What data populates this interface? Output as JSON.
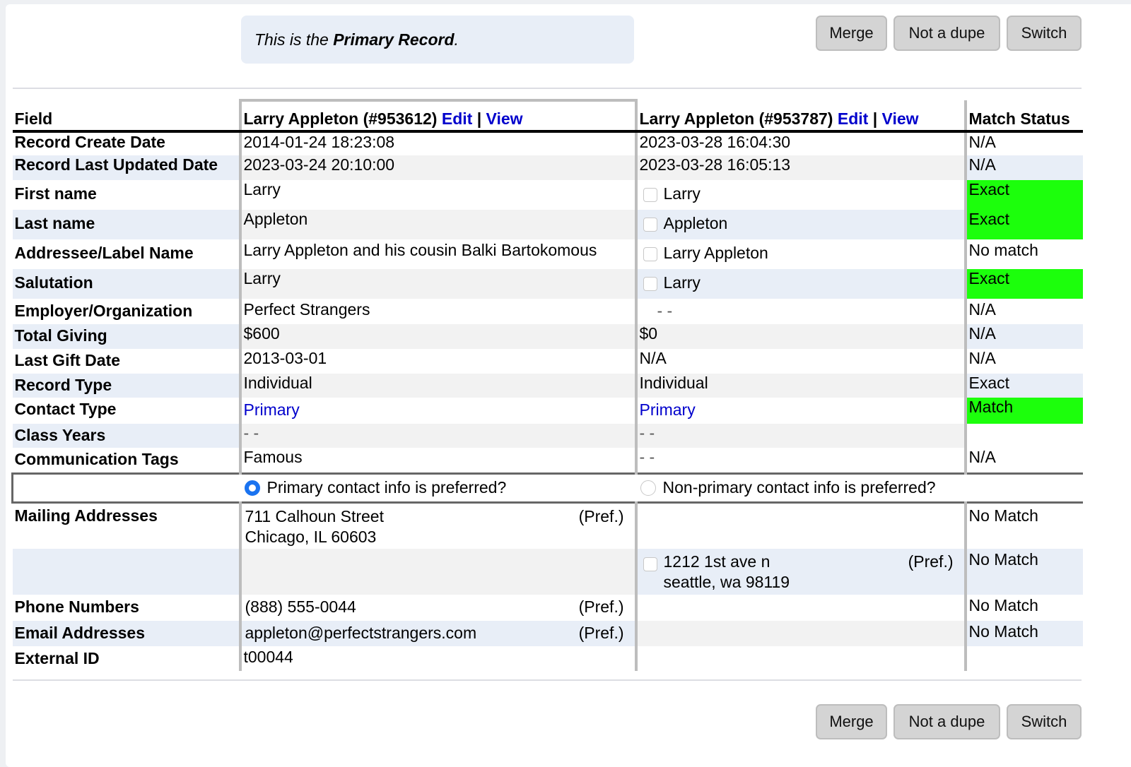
{
  "notice": {
    "prefix": "This is the ",
    "bold": "Primary Record",
    "suffix": "."
  },
  "buttons": {
    "merge": "Merge",
    "not_dupe": "Not a dupe",
    "switch": "Switch"
  },
  "header": {
    "field": "Field",
    "record1": {
      "name": "Larry Appleton (#953612)",
      "edit": "Edit",
      "sep": "|",
      "view": "View"
    },
    "record2": {
      "name": "Larry Appleton (#953787)",
      "edit": "Edit",
      "sep": "|",
      "view": "View"
    },
    "match": "Match Status"
  },
  "rows": [
    {
      "field": "Record Create Date",
      "r1": "2014-01-24 18:23:08",
      "r2": "2023-03-28 16:04:30",
      "match": "N/A"
    },
    {
      "field": "Record Last Updated Date",
      "r1": "2023-03-24 20:10:00",
      "r2": "2023-03-28 16:05:13",
      "match": "N/A"
    },
    {
      "field": "First name",
      "r1": "Larry",
      "r2": "Larry",
      "match": "Exact"
    },
    {
      "field": "Last name",
      "r1": "Appleton",
      "r2": "Appleton",
      "match": "Exact"
    },
    {
      "field": "Addressee/Label Name",
      "r1": "Larry Appleton and his cousin Balki Bartokomous",
      "r2": "Larry Appleton",
      "match": "No match"
    },
    {
      "field": "Salutation",
      "r1": "Larry",
      "r2": "Larry",
      "match": "Exact"
    },
    {
      "field": "Employer/Organization",
      "r1": "Perfect Strangers",
      "r2": "- -",
      "match": "N/A"
    },
    {
      "field": "Total Giving",
      "r1": "$600",
      "r2": "$0",
      "match": "N/A"
    },
    {
      "field": "Last Gift Date",
      "r1": "2013-03-01",
      "r2": "N/A",
      "match": "N/A"
    },
    {
      "field": "Record Type",
      "r1": "Individual",
      "r2": "Individual",
      "match": "Exact"
    },
    {
      "field": "Contact Type",
      "r1": "Primary",
      "r2": "Primary",
      "match": "Match"
    },
    {
      "field": "Class Years",
      "r1": "- -",
      "r2": "- -",
      "match": ""
    },
    {
      "field": "Communication Tags",
      "r1": "Famous",
      "r2": "- -",
      "match": "N/A"
    }
  ],
  "contact_pref": {
    "primary": {
      "label": "Primary contact info is preferred?",
      "checked": true
    },
    "nonprimary": {
      "label": "Non-primary contact info is preferred?",
      "checked": false
    }
  },
  "contact_rows": {
    "mailing_label": "Mailing Addresses",
    "mailing1": {
      "r1_line1": "711 Calhoun Street",
      "r1_line2": "Chicago, IL 60603",
      "r1_pref": "(Pref.)",
      "match": "No Match"
    },
    "mailing2": {
      "r2_line1": "1212 1st ave n",
      "r2_line2": "seattle, wa 98119",
      "r2_pref": "(Pref.)",
      "match": "No Match"
    },
    "phone": {
      "field": "Phone Numbers",
      "r1": "(888) 555-0044",
      "r1_pref": "(Pref.)",
      "match": "No Match"
    },
    "email": {
      "field": "Email Addresses",
      "r1": "appleton@perfectstrangers.com",
      "r1_pref": "(Pref.)",
      "match": "No Match"
    },
    "external": {
      "field": "External ID",
      "r1": "t00044"
    }
  },
  "colors": {
    "match_green": "#1cff0c",
    "link_blue": "#0000cc",
    "radio_blue": "#1a73f0"
  }
}
